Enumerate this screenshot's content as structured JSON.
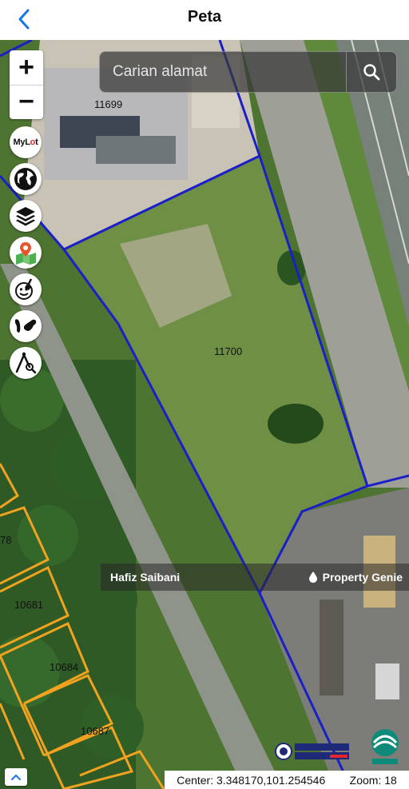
{
  "header": {
    "title": "Peta",
    "back_icon": "chevron-left-icon"
  },
  "search": {
    "placeholder": "Carian alamat",
    "value": "",
    "icon": "search-icon"
  },
  "zoom_controls": {
    "zoom_in_label": "+",
    "zoom_out_label": "−"
  },
  "tools": [
    {
      "name": "mylot",
      "label_my": "My",
      "label_l": "L",
      "label_o": "o",
      "label_t": "t"
    },
    {
      "name": "globe-icon"
    },
    {
      "name": "layers-icon"
    },
    {
      "name": "map-pin-icon"
    },
    {
      "name": "clear-broom-icon"
    },
    {
      "name": "malaysia-map-icon"
    },
    {
      "name": "measure-compass-icon"
    }
  ],
  "lots": [
    {
      "id": "11699",
      "label": "11699"
    },
    {
      "id": "11700",
      "label": "11700"
    },
    {
      "id": "10681",
      "label": "10681"
    },
    {
      "id": "10684",
      "label": "10684"
    },
    {
      "id": "10687",
      "label": "10687"
    },
    {
      "id": "partial-78",
      "label": "78"
    }
  ],
  "watermark": {
    "left": "Hafiz Saibani",
    "right": "Property Genie",
    "right_icon": "drop-icon"
  },
  "status": {
    "center_label": "Center: 3.348170,101.254546",
    "zoom_label": "Zoom: 18"
  },
  "colors": {
    "boundary_primary": "#1b1fc7",
    "boundary_secondary": "#f1a31f",
    "header_bg": "#ffffff",
    "accent": "#1a73e8"
  }
}
